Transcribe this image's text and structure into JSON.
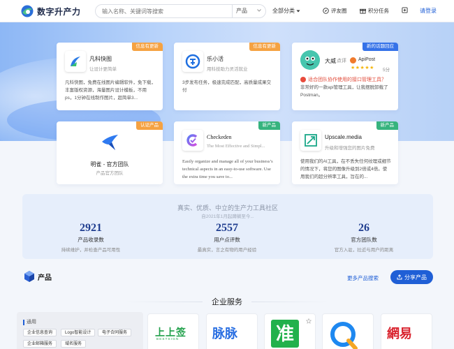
{
  "header": {
    "logo_text": "数字升产力",
    "search_placeholder": "输入名称、关键词等搜索",
    "search_select": "产品",
    "all_categories": "全部分类",
    "review": "评友圈",
    "tasks": "积分任务",
    "login": "请登录"
  },
  "cards": [
    {
      "name": "凡科快图",
      "sub": "让设计更简单",
      "badge": "信息有更新",
      "desc": "凡科快图，免费在线图片编辑软件，免下载，丰富版权资源，海量图片设计模板，不用ps，1分钟在线制作图片，超简单3..."
    },
    {
      "name": "乐小活",
      "sub": "用科技助力灵活就业",
      "badge": "信息有更新",
      "desc": "3步发布任务，极速完成匹配，高质量成果交付"
    },
    {
      "name": "大威",
      "reviewer_action": "点评",
      "reviewed_product": "ApiPost",
      "rating_text": "5分",
      "rating": 5,
      "badge": "新的话题回应",
      "question": "适合团队协作使用的接口管理工具？",
      "desc": "非常好的一款api管理工具，让我摆脱卸载了Postman。"
    },
    {
      "name": "明雀 - 官方团队",
      "sub": "产品官方团队",
      "badge": "认证产品"
    },
    {
      "name": "Checkeden",
      "sub": "The Most Effective and Simpl...",
      "badge": "新产品",
      "desc": "Easily organize and manage all of your business’s technical aspects in an easy-to-use software. Use the extra time you save to..."
    },
    {
      "name": "Upscale.media",
      "sub": "升级和增强您的图片免费",
      "badge": "新产品",
      "desc": "使用我们的AI工具，在不丢失任何纹理或细节的情况下，将您的图像升级到2倍或4倍。使用我们的超分辨率工具，旨在的..."
    }
  ],
  "stats": {
    "title": "真实、优质、中立的生产力工具社区",
    "subtitle": "自2021年1月起蹲躺至今...",
    "items": [
      {
        "num": "2921",
        "label": "产品收录数",
        "desc": "持续维护，并检查产品可用性"
      },
      {
        "num": "2557",
        "label": "用户点评数",
        "desc": "最真实，言之有物的用户经验"
      },
      {
        "num": "26",
        "label": "官方团队数",
        "desc": "官方入驻，拉近与用户的距离"
      }
    ]
  },
  "products": {
    "title": "产品",
    "more": "更多产品搜索",
    "share": "分享产品"
  },
  "enterprise": {
    "title": "企业服务",
    "category_head": "通用",
    "tags": [
      "企业信息查询",
      "Logo智能设计",
      "电子合同服务",
      "企业邮箱服务",
      "域名服务"
    ],
    "logos": [
      "上上签",
      "脉脉",
      "准",
      "",
      "網易"
    ],
    "logo_sub": "BESTSIGN"
  },
  "colors": {
    "accent": "#1f5fd6",
    "badge_orange": "#f5a242",
    "badge_green": "#36b37e",
    "badge_blue": "#3572e8"
  }
}
